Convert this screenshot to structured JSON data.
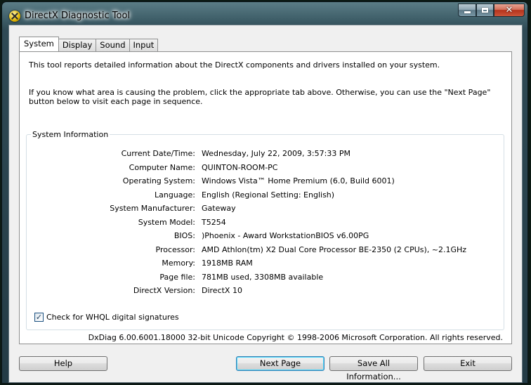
{
  "window": {
    "title": "DirectX Diagnostic Tool",
    "accent": "#3c7fb1",
    "close_color": "#c42b1c"
  },
  "caption_buttons": {
    "minimize_icon": "minimize-icon",
    "maximize_icon": "maximize-icon",
    "close_icon": "close-icon",
    "close_glyph": "✕"
  },
  "tabs": [
    {
      "label": "System",
      "active": true
    },
    {
      "label": "Display",
      "active": false
    },
    {
      "label": "Sound",
      "active": false
    },
    {
      "label": "Input",
      "active": false
    }
  ],
  "intro": {
    "line1": "This tool reports detailed information about the DirectX components and drivers installed on your system.",
    "line2": "If you know what area is causing the problem, click the appropriate tab above.  Otherwise, you can use the \"Next Page\" button below to visit each page in sequence."
  },
  "system_info": {
    "group_label": "System Information",
    "rows": [
      {
        "label": "Current Date/Time:",
        "value": "Wednesday, July 22, 2009, 3:57:33 PM"
      },
      {
        "label": "Computer Name:",
        "value": "QUINTON-ROOM-PC"
      },
      {
        "label": "Operating System:",
        "value": "Windows Vista™ Home Premium (6.0, Build 6001)"
      },
      {
        "label": "Language:",
        "value": "English (Regional Setting: English)"
      },
      {
        "label": "System Manufacturer:",
        "value": "Gateway"
      },
      {
        "label": "System Model:",
        "value": "T5254"
      },
      {
        "label": "BIOS:",
        "value": ")Phoenix - Award WorkstationBIOS v6.00PG"
      },
      {
        "label": "Processor:",
        "value": "AMD Athlon(tm) X2 Dual Core Processor BE-2350 (2 CPUs), ~2.1GHz"
      },
      {
        "label": "Memory:",
        "value": "1918MB RAM"
      },
      {
        "label": "Page file:",
        "value": "781MB used, 3308MB available"
      },
      {
        "label": "DirectX Version:",
        "value": "DirectX 10"
      }
    ],
    "whql_checkbox": {
      "label": "Check for WHQL digital signatures",
      "checked": true,
      "mark": "✓"
    }
  },
  "footer": {
    "version_text": "DxDiag 6.00.6001.18000 32-bit Unicode  Copyright © 1998-2006 Microsoft Corporation.  All rights reserved."
  },
  "buttons": {
    "help": "Help",
    "next_page": "Next Page",
    "save_all": "Save All Information...",
    "exit": "Exit"
  }
}
